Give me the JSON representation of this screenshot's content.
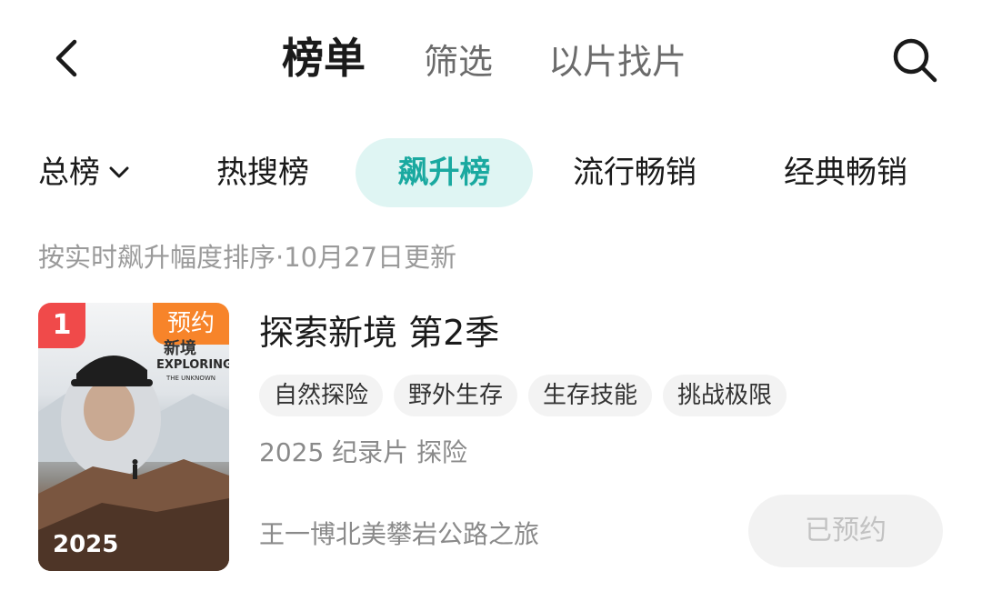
{
  "nav": {
    "tabs": [
      {
        "label": "榜单",
        "active": true
      },
      {
        "label": "筛选",
        "active": false
      },
      {
        "label": "以片找片",
        "active": false
      }
    ],
    "back_icon": "chevron-left-icon",
    "search_icon": "search-icon"
  },
  "categories": [
    {
      "label": "总榜",
      "has_dropdown": true
    },
    {
      "label": "热搜榜"
    },
    {
      "label": "飙升榜",
      "active": true
    },
    {
      "label": "流行畅销"
    },
    {
      "label": "经典畅销"
    }
  ],
  "sort_caption": "按实时飙升幅度排序·10月27日更新",
  "items": [
    {
      "rank": "1",
      "badge": "预约",
      "poster_year": "2025",
      "poster_title_cn": "新境",
      "poster_title_en": "EXPLORING",
      "poster_subtitle_en": "THE UNKNOWN",
      "title": "探索新境 第2季",
      "tags": [
        "自然探险",
        "野外生存",
        "生存技能",
        "挑战极限"
      ],
      "meta": "2025 纪录片 探险",
      "description": "王一博北美攀岩公路之旅",
      "action_label": "已预约"
    }
  ],
  "colors": {
    "accent": "#1aa9a0",
    "accent_bg": "#dff5f3",
    "rank_badge": "#f04a4a",
    "reserve_badge": "#f7842a"
  }
}
